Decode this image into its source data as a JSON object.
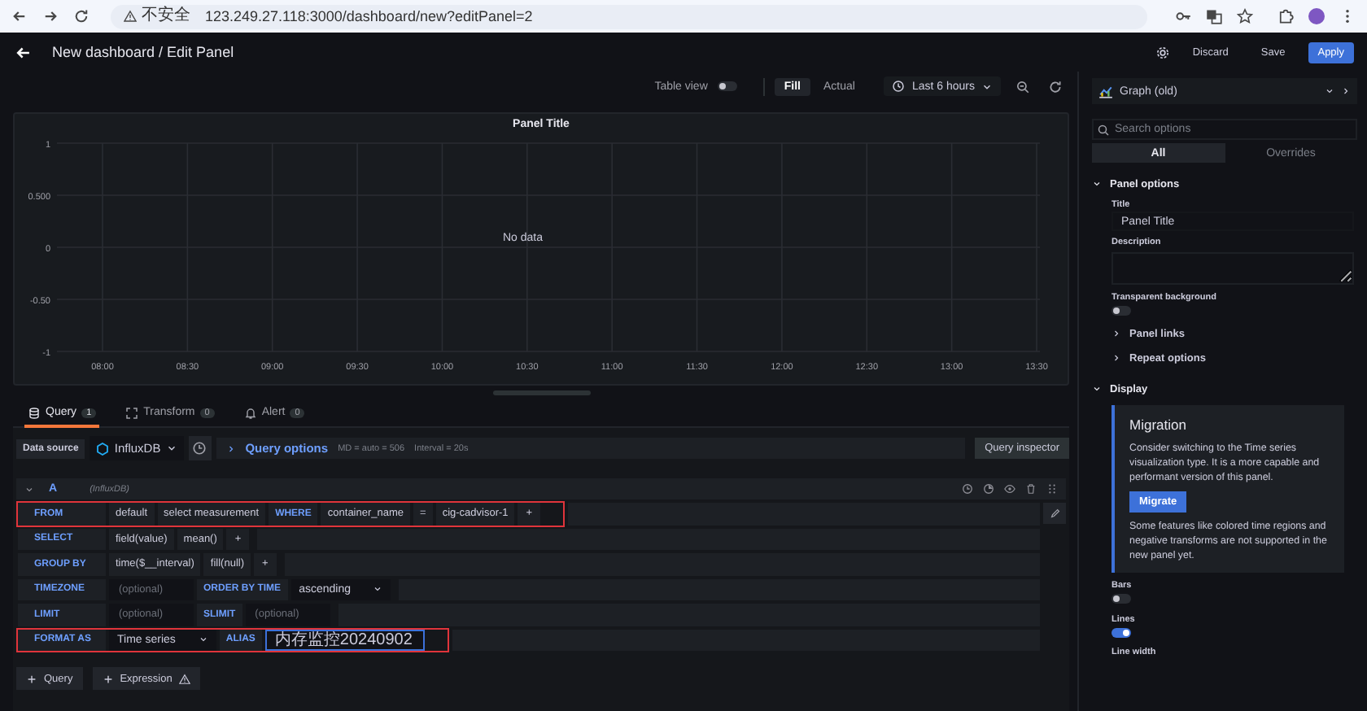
{
  "browser": {
    "security_label": "不安全",
    "url": "123.249.27.118:3000/dashboard/new?editPanel=2"
  },
  "header": {
    "title": "New dashboard / Edit Panel",
    "buttons": [
      {
        "label": "Discard",
        "kind": "secondary"
      },
      {
        "label": "Save",
        "kind": "secondary"
      },
      {
        "label": "Apply",
        "kind": "primary"
      }
    ]
  },
  "toolbar": {
    "table_view_label": "Table view",
    "table_view_on": false,
    "view_modes": [
      {
        "label": "Fill",
        "selected": true
      },
      {
        "label": "Actual",
        "selected": false
      }
    ],
    "time_range": "Last 6 hours"
  },
  "panel": {
    "title": "Panel Title",
    "message": "No data",
    "chart_data": {
      "type": "line",
      "grid": true,
      "categories": [
        "08:00",
        "08:30",
        "09:00",
        "09:30",
        "10:00",
        "10:30",
        "11:00",
        "11:30",
        "12:00",
        "12:30",
        "13:00",
        "13:30"
      ],
      "ylim": [
        -1,
        1
      ],
      "yticks": [
        {
          "value": 1,
          "label": "1"
        },
        {
          "value": 0.5,
          "label": "0.500"
        },
        {
          "value": 0,
          "label": "0"
        },
        {
          "value": -0.5,
          "label": "-0.50"
        },
        {
          "value": -1,
          "label": "-1"
        }
      ]
    }
  },
  "query_tabs": [
    {
      "label": "Query",
      "count": "1",
      "kind": "query",
      "selected": true
    },
    {
      "label": "Transform",
      "count": "0",
      "kind": "transform",
      "selected": false
    },
    {
      "label": "Alert",
      "count": "0",
      "kind": "alert",
      "selected": false
    }
  ],
  "data_source": {
    "label": "Data source",
    "name": "InfluxDB",
    "options_link": "Query options",
    "summary": "MD = auto = 506",
    "interval": "Interval = 20s",
    "inspector_button": "Query inspector"
  },
  "query": {
    "ref": "A",
    "source": "(InfluxDB)",
    "rows": [
      {
        "label": "FROM",
        "highlighted": true,
        "parts": [
          {
            "kind": "segment",
            "text": "default"
          },
          {
            "kind": "segment",
            "text": "select measurement"
          },
          {
            "kind": "keyword",
            "text": "WHERE"
          },
          {
            "kind": "segment",
            "text": "container_name"
          },
          {
            "kind": "segment",
            "text": "="
          },
          {
            "kind": "segment",
            "text": "cig-cadvisor-1"
          },
          {
            "kind": "add",
            "text": "+"
          }
        ]
      },
      {
        "label": "SELECT",
        "highlighted": false,
        "parts": [
          {
            "kind": "segment",
            "text": "field(value)"
          },
          {
            "kind": "segment",
            "text": "mean()"
          },
          {
            "kind": "add",
            "text": "+"
          }
        ]
      },
      {
        "label": "GROUP BY",
        "highlighted": false,
        "parts": [
          {
            "kind": "segment",
            "text": "time($__interval)"
          },
          {
            "kind": "segment",
            "text": "fill(null)"
          },
          {
            "kind": "add",
            "text": "+"
          }
        ]
      },
      {
        "label": "TIMEZONE",
        "highlighted": false,
        "parts": [
          {
            "kind": "input",
            "placeholder": "(optional)",
            "focused": false
          },
          {
            "kind": "keyword",
            "text": "ORDER BY TIME"
          },
          {
            "kind": "select",
            "text": "ascending"
          }
        ]
      },
      {
        "label": "LIMIT",
        "highlighted": false,
        "parts": [
          {
            "kind": "input",
            "placeholder": "(optional)",
            "focused": false
          },
          {
            "kind": "keyword",
            "text": "SLIMIT"
          },
          {
            "kind": "input",
            "placeholder": "(optional)",
            "focused": false
          }
        ]
      },
      {
        "label": "FORMAT AS",
        "highlighted": true,
        "parts": [
          {
            "kind": "select",
            "text": "Time series"
          },
          {
            "kind": "keyword",
            "text": "ALIAS"
          },
          {
            "kind": "input",
            "value": "内存监控20240902",
            "focused": true
          }
        ]
      }
    ]
  },
  "add_buttons": [
    {
      "label": "Query",
      "kind": "plain"
    },
    {
      "label": "Expression",
      "kind": "warning"
    }
  ],
  "visualization": {
    "name": "Graph (old)"
  },
  "options_search": {
    "placeholder": "Search options"
  },
  "options_tabs": [
    {
      "label": "All",
      "selected": true
    },
    {
      "label": "Overrides",
      "selected": false
    }
  ],
  "panel_options": {
    "title": "Panel options",
    "expanded": true,
    "fields": [
      {
        "kind": "input",
        "label": "Title",
        "value": "Panel Title"
      },
      {
        "kind": "textarea",
        "label": "Description"
      },
      {
        "kind": "switch",
        "label": "Transparent background",
        "on": false
      }
    ],
    "groups": [
      {
        "label": "Panel links",
        "expanded": false
      },
      {
        "label": "Repeat options",
        "expanded": false
      }
    ]
  },
  "display": {
    "title": "Display",
    "expanded": true,
    "migration": {
      "title": "Migration",
      "text": "Consider switching to the Time series visualization type. It is a more capable and performant version of this panel.",
      "button": "Migrate",
      "note": "Some features like colored time regions and negative transforms are not supported in the new panel yet."
    },
    "fields": [
      {
        "kind": "switch",
        "label": "Bars",
        "on": false
      },
      {
        "kind": "switch",
        "label": "Lines",
        "on": true
      },
      {
        "kind": "label",
        "label": "Line width"
      }
    ]
  }
}
